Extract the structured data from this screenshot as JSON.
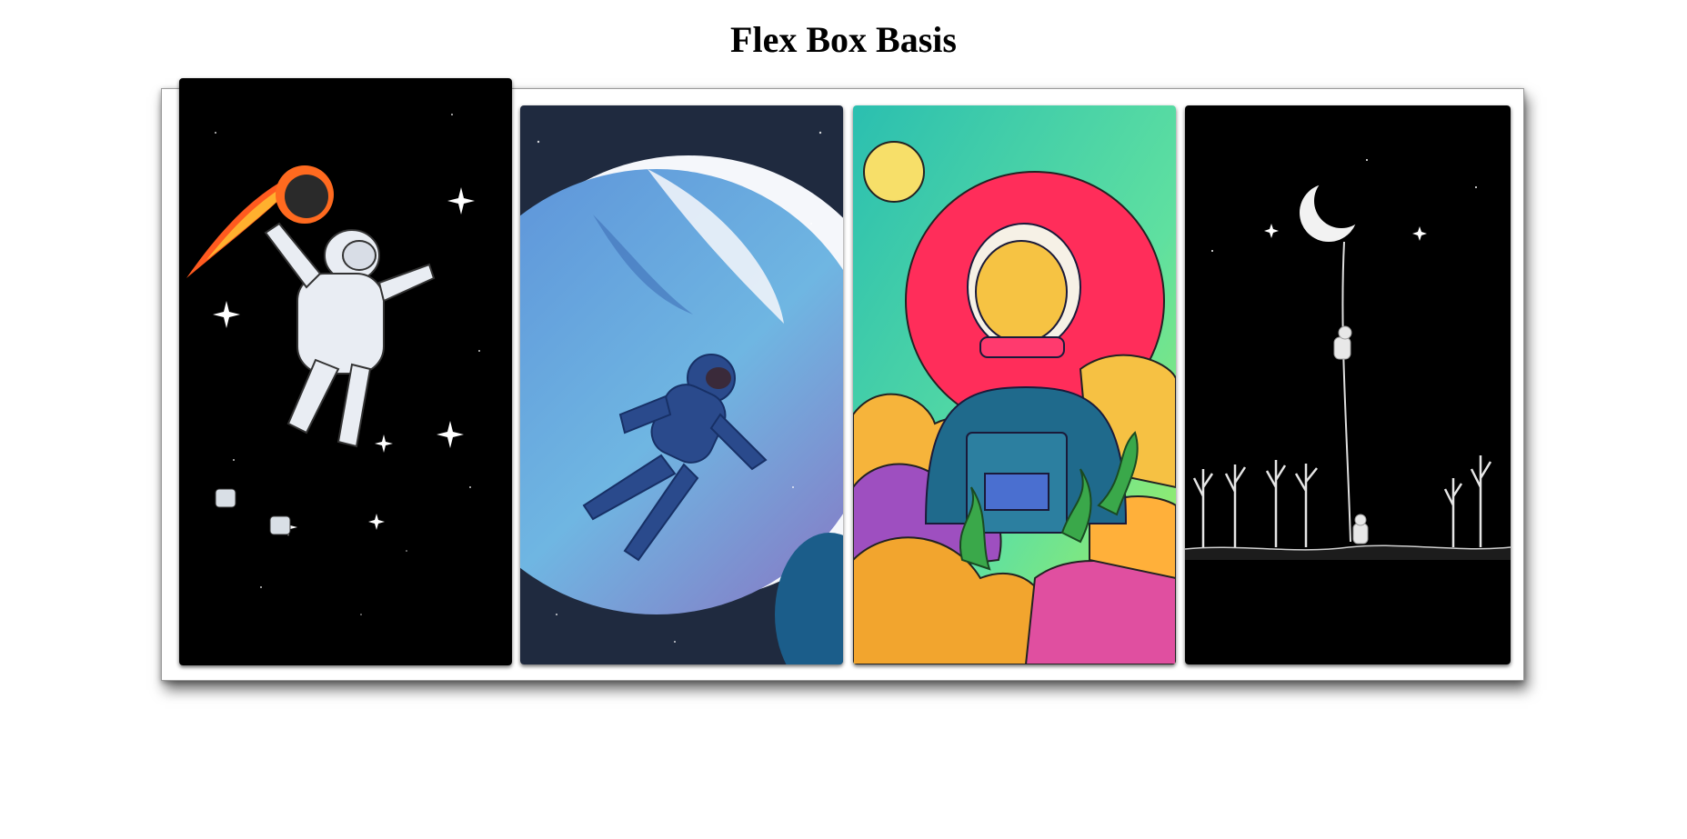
{
  "page": {
    "title": "Flex Box Basis"
  },
  "gallery": {
    "cards": [
      {
        "name": "astronaut-dunking-meteor",
        "background": "#000000"
      },
      {
        "name": "astronaut-floating-by-planet",
        "background": "#1f2a3f"
      },
      {
        "name": "astronaut-colorful-illustration",
        "background": "#2fc7b0"
      },
      {
        "name": "astronaut-climbing-rope-to-moon",
        "background": "#000000"
      }
    ]
  },
  "colors": {
    "accent_red": "#ff2d5a",
    "sun_yellow": "#f7df69",
    "planet_blue": "#6fa6e0"
  }
}
